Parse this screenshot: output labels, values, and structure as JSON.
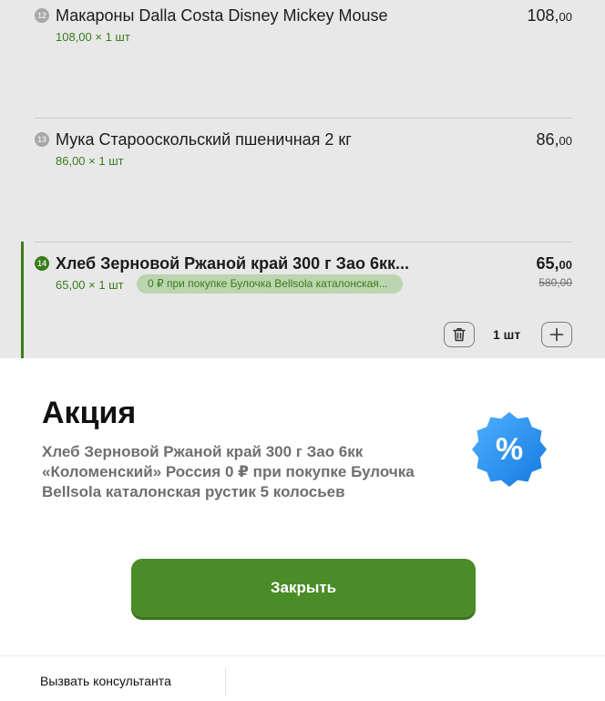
{
  "items": [
    {
      "number": "12",
      "title": "Макароны Dalla Costa Disney Mickey Mouse",
      "subtitle": "108,00 × 1 шт",
      "price_int": "108,",
      "price_frac": "00"
    },
    {
      "number": "13",
      "title": "Мука Старооскольский пшеничная 2 кг",
      "subtitle": "86,00 × 1 шт",
      "price_int": "86,",
      "price_frac": "00"
    },
    {
      "number": "14",
      "title": "Хлеб Зерновой Ржаной край 300 г Зао 6кк...",
      "subtitle": "65,00 × 1 шт",
      "promo": "0 ₽ при покупке Булочка Bellsola каталонская...",
      "price_int": "65,",
      "price_frac": "00",
      "old_price": "580,00",
      "quantity": "1 шт"
    }
  ],
  "icons": {
    "trash": "trash-icon",
    "plus": "plus-icon",
    "percent_badge": "percent-badge-icon"
  },
  "modal": {
    "title": "Акция",
    "description": "Хлеб Зерновой Ржаной край 300 г Зао 6кк «Коломенский» Россия 0 ₽ при покупке Булочка Bellsola каталонская рустик 5 колосьев",
    "badge_symbol": "%",
    "close_label": "Закрыть"
  },
  "footer": {
    "consultant_label": "Вызвать консультанта"
  },
  "colors": {
    "brand_green": "#4a8c27",
    "promo_chip_bg": "#cfe9c1",
    "badge_blue": "#2196f3"
  }
}
